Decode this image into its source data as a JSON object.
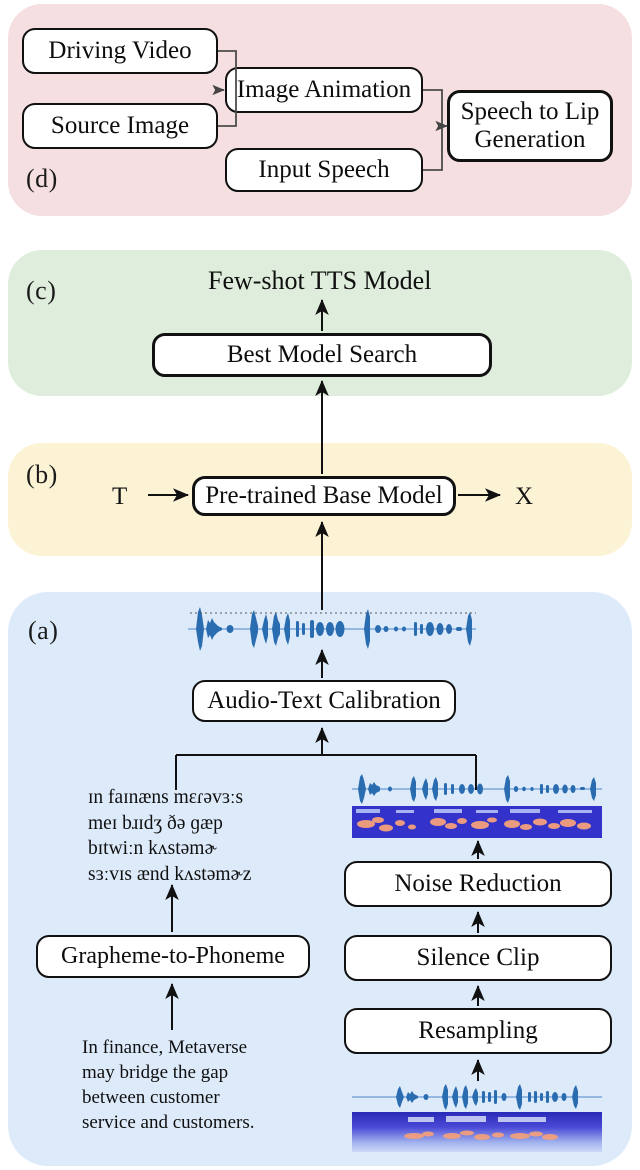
{
  "figure": {
    "panels": [
      {
        "id": "d",
        "label": "(d)",
        "accent": "#f6dfe0"
      },
      {
        "id": "c",
        "label": "(c)",
        "accent": "#dfeedc"
      },
      {
        "id": "b",
        "label": "(b)",
        "accent": "#fcf3d5"
      },
      {
        "id": "a",
        "label": "(a)",
        "accent": "#ddeafa"
      }
    ]
  },
  "panel_d": {
    "label": "(d)",
    "nodes": {
      "driving_video": "Driving Video",
      "source_image": "Source Image",
      "image_animation": "Image Animation",
      "input_speech": "Input Speech",
      "speech_to_lip": "Speech to Lip\nGeneration"
    }
  },
  "panel_c": {
    "label": "(c)",
    "output_title": "Few-shot TTS Model",
    "nodes": {
      "best_model_search": "Best Model Search"
    }
  },
  "panel_b": {
    "label": "(b)",
    "input_symbol": "T",
    "output_symbol": "X",
    "nodes": {
      "pretrained_base_model": "Pre-trained Base Model"
    }
  },
  "panel_a": {
    "label": "(a)",
    "nodes": {
      "audio_text_calibration": "Audio-Text Calibration",
      "grapheme_to_phoneme": "Grapheme-to-Phoneme",
      "noise_reduction": "Noise Reduction",
      "silence_clip": "Silence Clip",
      "resampling": "Resampling"
    },
    "phoneme_text": "ɪn faɪnæns mɛɾəvɜːs\nmeɪ bɹɪdʒ ðə ɡæp\nbɪtwiːn kʌstəmɚ\nsɜːvɪs ænd kʌstəmɚz",
    "source_text": "In finance, Metaverse\nmay bridge the gap\nbetween customer\nservice and customers.",
    "media": {
      "top_waveform": "calibrated-speech-waveform",
      "mid_waveform": "denoised-speech-waveform",
      "mid_spectrogram": "denoised-speech-spectrogram",
      "bottom_waveform": "raw-speech-waveform",
      "bottom_spectrogram": "raw-speech-spectrogram"
    }
  },
  "colors": {
    "waveform": "#2a6cb0",
    "spectrogram_bg": "#3333cc",
    "spectrogram_hot": "#f4a07a",
    "stroke": "#111111"
  }
}
